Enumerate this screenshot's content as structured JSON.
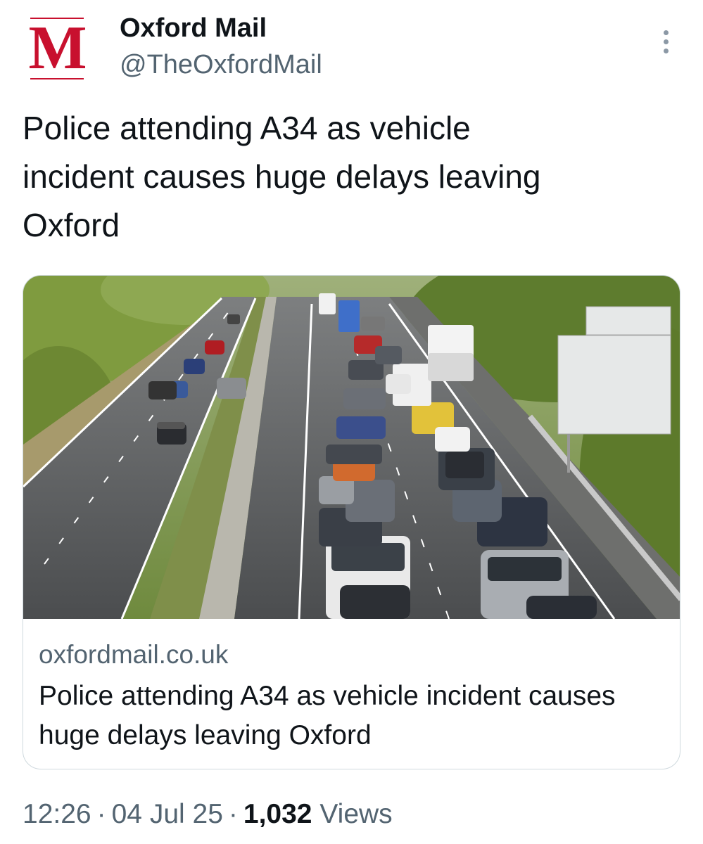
{
  "author": {
    "avatar_letter": "M",
    "display_name": "Oxford Mail",
    "handle": "@TheOxfordMail",
    "brand_color": "#c8102e"
  },
  "header": {
    "more_icon": "more-vertical-icon"
  },
  "tweet": {
    "text": "Police attending A34 as vehicle\nincident causes huge delays leaving\nOxford"
  },
  "card": {
    "image_description": "traffic-photo",
    "domain": "oxfordmail.co.uk",
    "title": "Police attending A34 as vehicle incident causes huge delays leaving Oxford"
  },
  "meta": {
    "time": "12:26",
    "separator": "·",
    "date": "04 Jul 25",
    "views_count": "1,032",
    "views_label": "Views"
  },
  "colors": {
    "text_primary": "#0f1419",
    "text_secondary": "#536471",
    "border": "#cfd9de"
  }
}
